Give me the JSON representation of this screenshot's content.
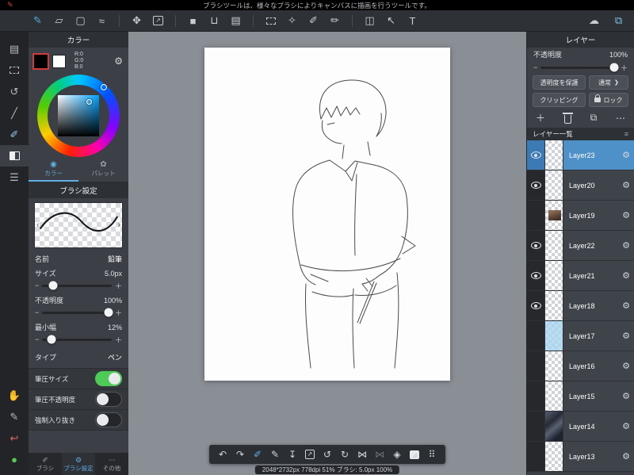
{
  "glyphs": {
    "gear": "⚙",
    "minus": "−",
    "plus": "＋",
    "prev": "‹",
    "next": "›",
    "dots": "⋯",
    "add": "＋",
    "merge": "⧉",
    "handle": "≡"
  },
  "top_bar": {
    "message": "ブラシツールは、様々なブラシによりキャンバスに描画を行うツールです。",
    "app_icon_glyph": "✎"
  },
  "toolbar": {
    "tools": [
      {
        "name": "brush-tool",
        "glyph": "✎",
        "color": "#55aade",
        "active": true
      },
      {
        "name": "eraser-tool",
        "glyph": "▱"
      },
      {
        "name": "shape-brush-tool",
        "glyph": "▢"
      },
      {
        "name": "scatter-brush-tool",
        "glyph": "≈"
      },
      {
        "divider": true
      },
      {
        "name": "move-tool",
        "glyph": "✥"
      },
      {
        "name": "canvas-export-tool",
        "glyph": "↗",
        "kind": "boxed"
      },
      {
        "divider": true
      },
      {
        "name": "fill-tool",
        "glyph": "■"
      },
      {
        "name": "bucket-tool",
        "glyph": "⊔"
      },
      {
        "name": "gradient-tool",
        "glyph": "▤"
      },
      {
        "divider": true
      },
      {
        "name": "select-tool",
        "glyph": "",
        "kind": "dashed"
      },
      {
        "name": "magic-wand-tool",
        "glyph": "✧"
      },
      {
        "name": "select-pen-tool",
        "glyph": "✐"
      },
      {
        "name": "select-eraser-tool",
        "glyph": "✏"
      },
      {
        "divider": true
      },
      {
        "name": "divide-tool",
        "glyph": "◫"
      },
      {
        "name": "operation-tool",
        "glyph": "↖"
      },
      {
        "name": "text-tool",
        "glyph": "T"
      }
    ],
    "right_tools": [
      {
        "name": "cloud-tool",
        "glyph": "☁"
      },
      {
        "name": "layers-panel-toggle",
        "glyph": "⧉",
        "color": "#7fc4e8"
      }
    ]
  },
  "left_rail": {
    "top_icons": [
      {
        "name": "file-menu",
        "glyph": "▤"
      },
      {
        "name": "select-menu",
        "glyph": "",
        "kind": "dashed"
      },
      {
        "name": "view-reset",
        "glyph": "↺"
      },
      {
        "name": "snap-ruler",
        "glyph": "╱"
      },
      {
        "name": "brush-panel-toggle",
        "glyph": "✐",
        "color": "#8fc8e8"
      },
      {
        "name": "tool-panel-toggle",
        "glyph": "",
        "kind": "panels",
        "active": true
      },
      {
        "name": "material-panel-toggle",
        "glyph": "☰"
      }
    ],
    "bottom_icons": [
      {
        "name": "hand-tool",
        "glyph": "✋"
      },
      {
        "name": "pen-mode",
        "glyph": "✎"
      },
      {
        "name": "back-arrow",
        "glyph": "↩",
        "color": "#e0685f"
      },
      {
        "name": "status-dot",
        "glyph": "●",
        "color": "#57c957"
      }
    ]
  },
  "color_panel": {
    "title": "カラー",
    "foreground_color": "#000000",
    "background_color": "#ffffff",
    "rgb": [
      "R:0",
      "G:0",
      "B:0"
    ],
    "tabs": [
      {
        "label": "カラー",
        "glyph": "◉",
        "active": true
      },
      {
        "label": "パレット",
        "glyph": "✿"
      }
    ]
  },
  "brush_panel": {
    "title": "ブラシ設定",
    "name_label": "名前",
    "name_value": "鉛筆",
    "params": [
      {
        "label": "サイズ",
        "value": "5.0px",
        "pct": "16%"
      },
      {
        "label": "不透明度",
        "value": "100%",
        "pct": "95%"
      },
      {
        "label": "最小幅",
        "value": "12%",
        "pct": "13%"
      }
    ],
    "type_label": "タイプ",
    "type_value": "ペン",
    "toggles": [
      {
        "label": "筆圧サイズ",
        "on": true
      },
      {
        "label": "筆圧不透明度",
        "on": false
      },
      {
        "label": "強制入り抜き",
        "on": false
      }
    ],
    "bottom_tabs": [
      {
        "label": "ブラシ",
        "glyph": "✐"
      },
      {
        "label": "ブラシ設定",
        "glyph": "⚙",
        "active": true
      },
      {
        "label": "その他",
        "glyph": "⋯"
      }
    ]
  },
  "layers_panel": {
    "title": "レイヤー",
    "opacity_label": "不透明度",
    "opacity_value": "100%",
    "opacity_pct": "96%",
    "protect_label": "透明度を保護",
    "blend_label": "通常",
    "blend_chevron": "❯",
    "clipping_label": "クリッピング",
    "lock_label": "ロック",
    "list_label": "レイヤー一覧",
    "layers": [
      {
        "name": "Layer23",
        "visible": true,
        "selected": true,
        "thumb": "empty"
      },
      {
        "name": "Layer20",
        "visible": true,
        "thumb": "empty"
      },
      {
        "name": "Layer19",
        "visible": false,
        "thumb": "photo"
      },
      {
        "name": "Layer22",
        "visible": true,
        "thumb": "empty"
      },
      {
        "name": "Layer21",
        "visible": true,
        "thumb": "empty"
      },
      {
        "name": "Layer18",
        "visible": true,
        "thumb": "empty"
      },
      {
        "name": "Layer17",
        "visible": false,
        "thumb": "blue"
      },
      {
        "name": "Layer16",
        "visible": false,
        "thumb": "empty"
      },
      {
        "name": "Layer15",
        "visible": false,
        "thumb": "empty"
      },
      {
        "name": "Layer14",
        "visible": false,
        "thumb": "sketch"
      },
      {
        "name": "Layer13",
        "visible": false,
        "thumb": "empty"
      }
    ]
  },
  "bottom_toolbar": {
    "items": [
      {
        "name": "undo-button",
        "glyph": "↶"
      },
      {
        "name": "redo-button",
        "glyph": "↷"
      },
      {
        "name": "snap-brush-button",
        "glyph": "✐",
        "color": "#5fb0e8"
      },
      {
        "name": "pen-button",
        "glyph": "✎"
      },
      {
        "name": "save-button",
        "glyph": "↧"
      },
      {
        "name": "export-button",
        "glyph": "↗",
        "kind": "boxed"
      },
      {
        "name": "rotate-left-button",
        "glyph": "↺"
      },
      {
        "name": "rotate-right-button",
        "glyph": "↻"
      },
      {
        "name": "flip-horizontal-button",
        "glyph": "⋈"
      },
      {
        "name": "flip-reset-button",
        "glyph": "⋈",
        "color": "#6d7178"
      },
      {
        "name": "clear-button",
        "glyph": "◈"
      },
      {
        "name": "material-button",
        "glyph": "◢",
        "kind": "img"
      },
      {
        "name": "drag-handle",
        "glyph": "⠿"
      }
    ]
  },
  "status_bar": {
    "text": "2048*2732px 778dpi 51% ブラシ: 5.0px 100%"
  }
}
